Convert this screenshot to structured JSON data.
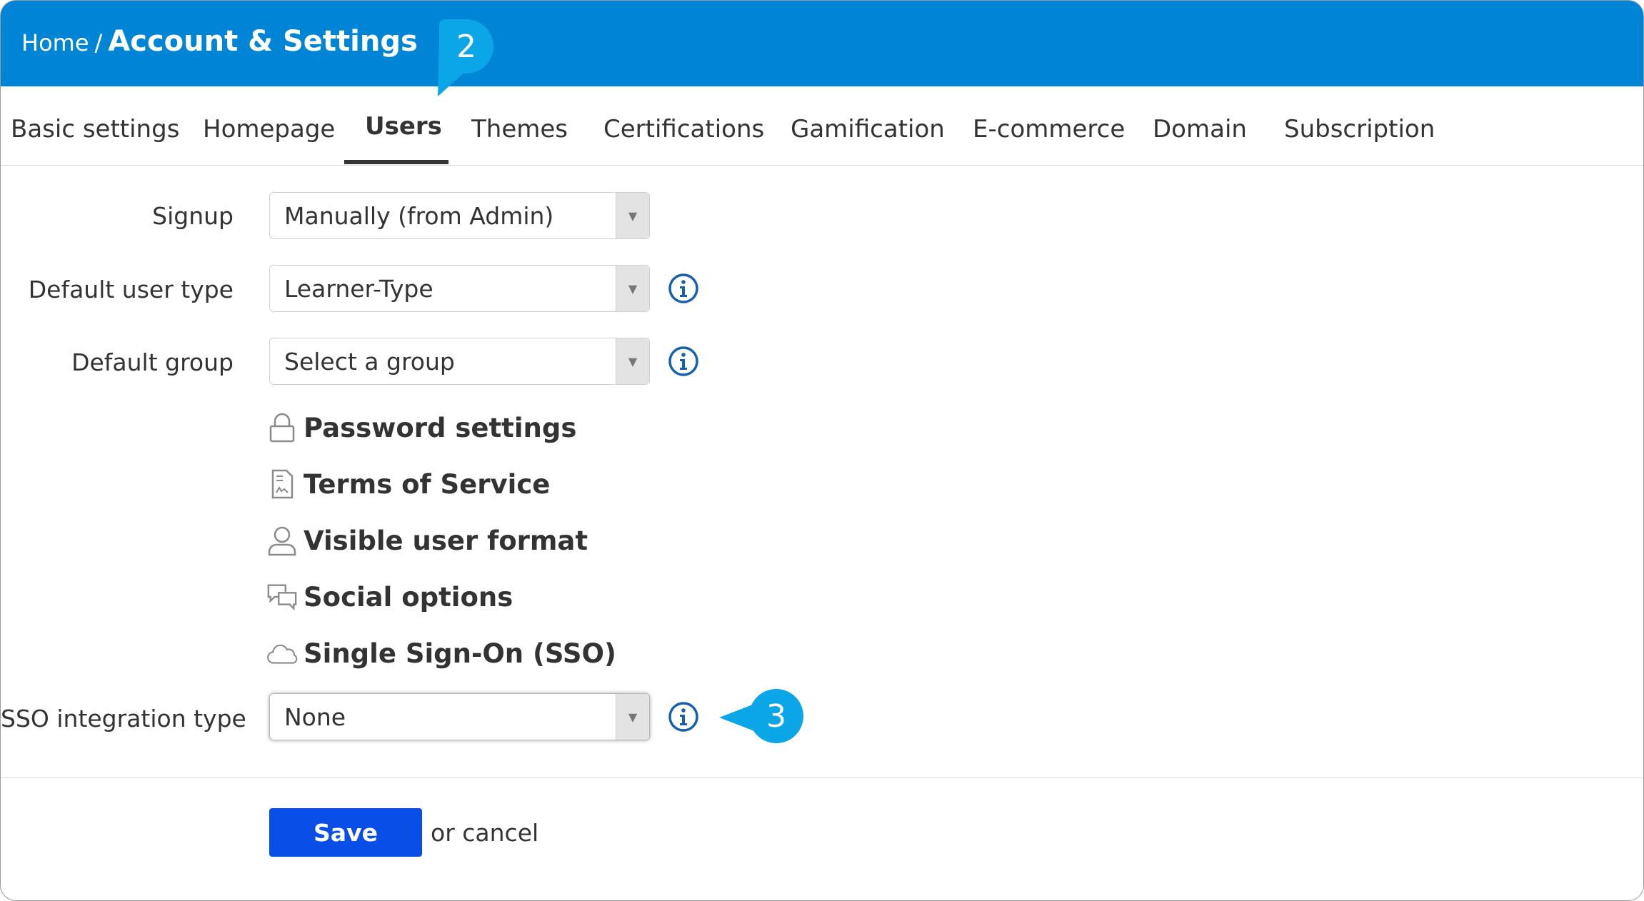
{
  "breadcrumb": {
    "home": "Home",
    "separator": "/",
    "current": "Account & Settings"
  },
  "callouts": [
    "2",
    "3"
  ],
  "tabs": [
    {
      "label": "Basic settings",
      "active": false
    },
    {
      "label": "Homepage",
      "active": false
    },
    {
      "label": "Users",
      "active": true
    },
    {
      "label": "Themes",
      "active": false
    },
    {
      "label": "Certifications",
      "active": false
    },
    {
      "label": "Gamification",
      "active": false
    },
    {
      "label": "E-commerce",
      "active": false
    },
    {
      "label": "Domain",
      "active": false
    },
    {
      "label": "Subscription",
      "active": false
    }
  ],
  "form": {
    "signup": {
      "label": "Signup",
      "value": "Manually (from Admin)"
    },
    "default_user_type": {
      "label": "Default user type",
      "value": "Learner-Type"
    },
    "default_group": {
      "label": "Default group",
      "value": "Select a group"
    },
    "sso_integration_type": {
      "label": "SSO integration type",
      "value": "None"
    }
  },
  "sections": [
    {
      "label": "Password settings",
      "icon": "lock-icon"
    },
    {
      "label": "Terms of Service",
      "icon": "document-icon"
    },
    {
      "label": "Visible user format",
      "icon": "user-icon"
    },
    {
      "label": "Social options",
      "icon": "chat-bubbles-icon"
    },
    {
      "label": "Single Sign-On (SSO)",
      "icon": "cloud-icon"
    }
  ],
  "footer": {
    "save_label": "Save",
    "or_text": "or",
    "cancel_label": "cancel"
  },
  "colors": {
    "header_bg": "#0085d6",
    "callout": "#0ba6e8",
    "info_icon": "#1560b0",
    "save_button": "#0a4ee8"
  }
}
